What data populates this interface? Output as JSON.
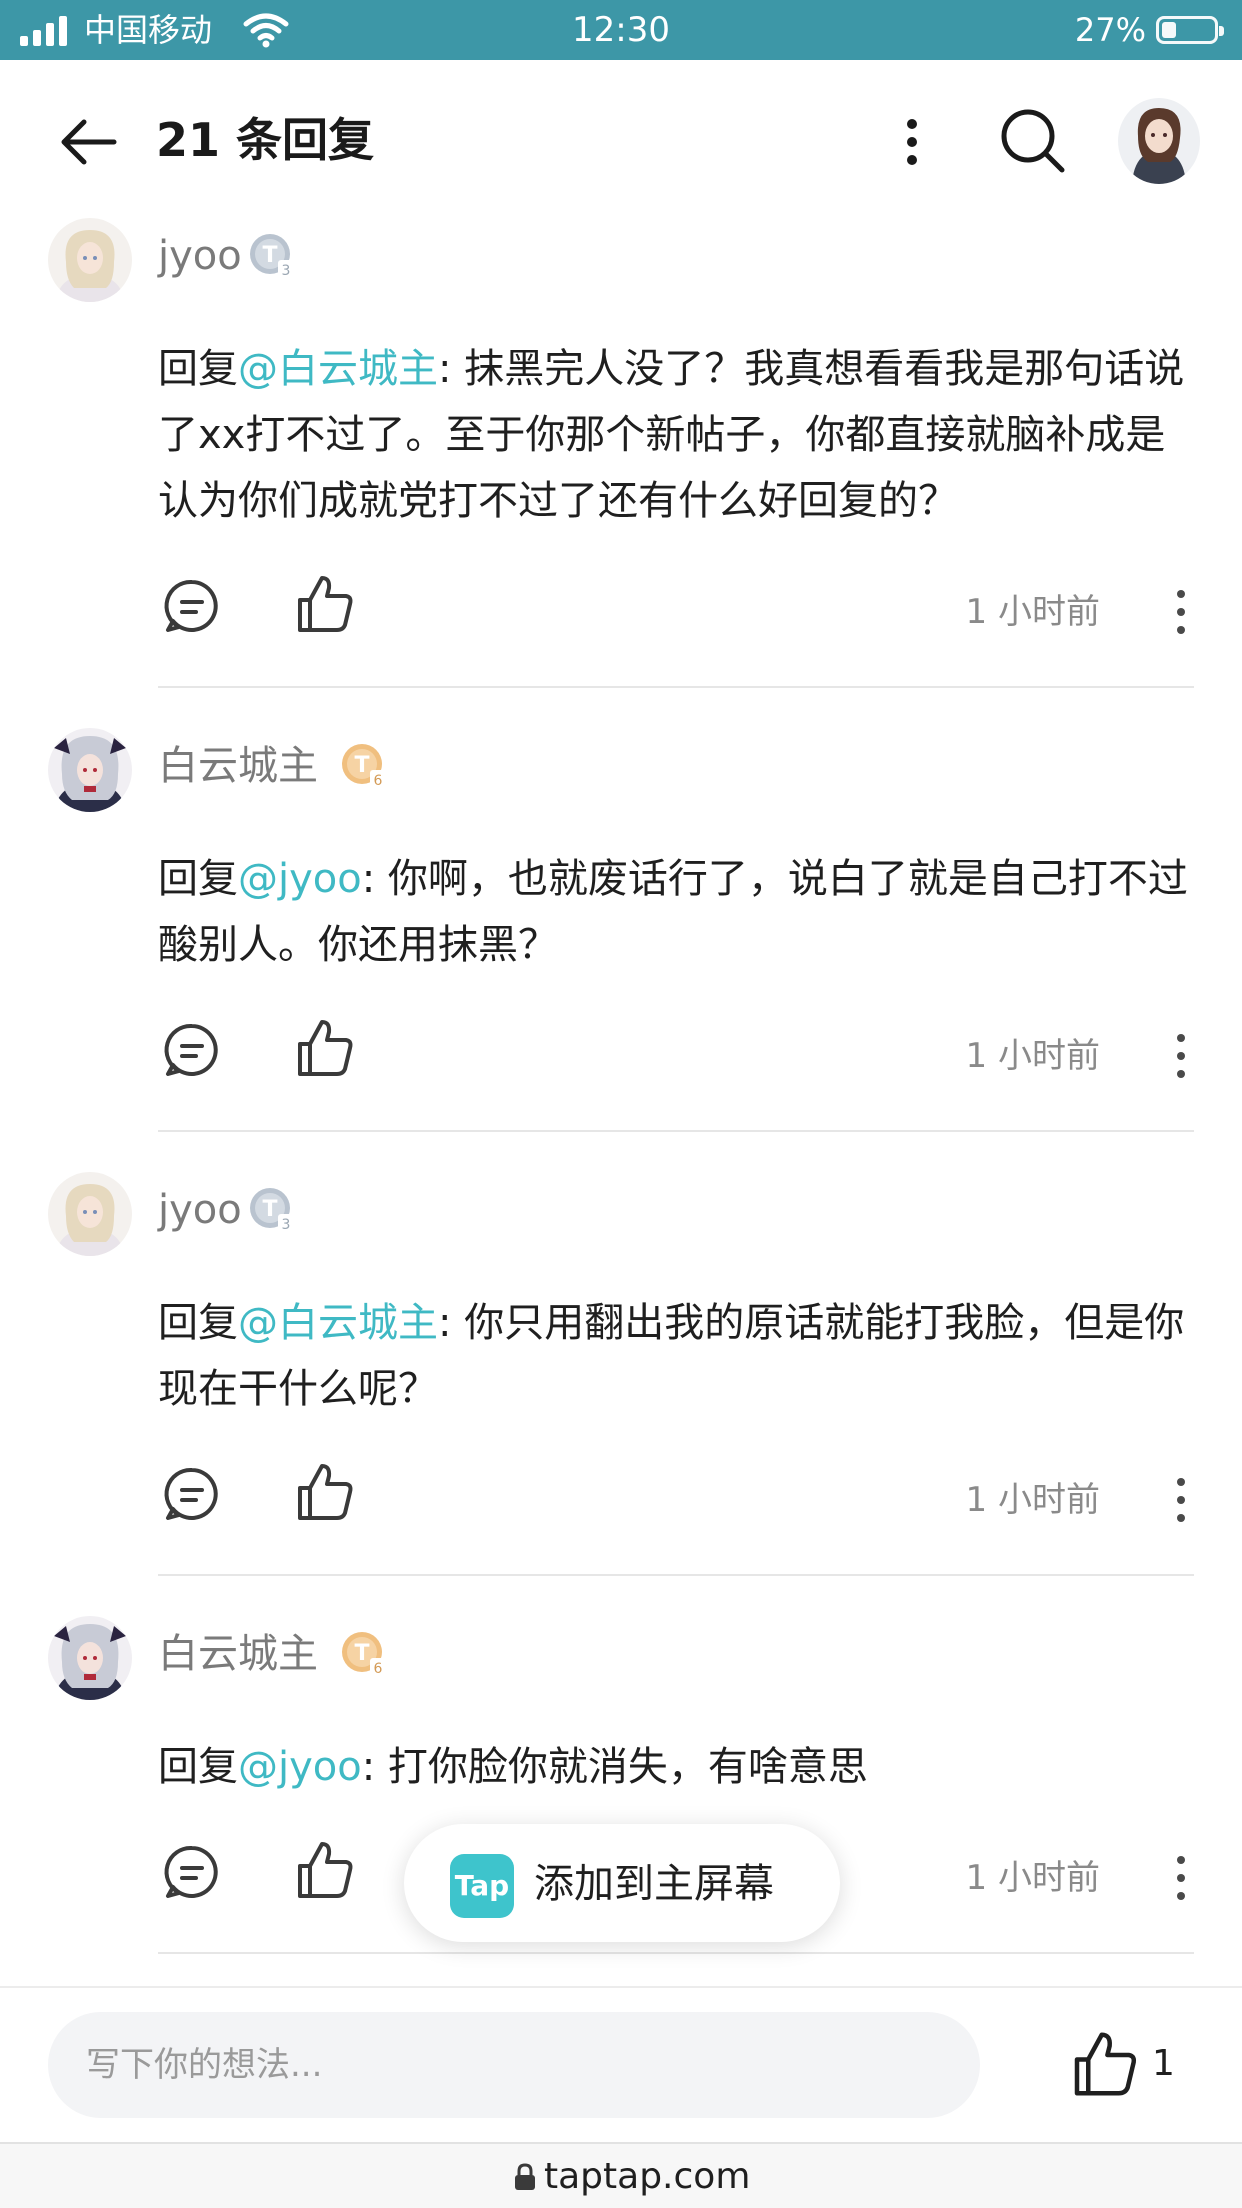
{
  "status_bar": {
    "carrier": "中国移动",
    "time": "12:30",
    "battery": "27%",
    "battery_level": 0.27
  },
  "header": {
    "title": "21 条回复",
    "icons": [
      "back-arrow-icon",
      "more-vertical-icon",
      "search-icon",
      "user-avatar"
    ]
  },
  "comments": [
    {
      "user": "jyoo",
      "badge_level": "3",
      "prefix": "回复",
      "mention": "@白云城主",
      "text": ": 抹黑完人没了？我真想看看我是那句话说了xx打不过了。至于你那个新帖子，你都直接就脑补成是认为你们成就党打不过了还有什么好回复的？",
      "time": "1 小时前"
    },
    {
      "user": "白云城主",
      "badge_level": "6",
      "prefix": "回复",
      "mention": "@jyoo",
      "text": ": 你啊，也就废话行了，说白了就是自己打不过酸别人。你还用抹黑？",
      "time": "1 小时前"
    },
    {
      "user": "jyoo",
      "badge_level": "3",
      "prefix": "回复",
      "mention": "@白云城主",
      "text": ": 你只用翻出我的原话就能打我脸，但是你现在干什么呢？",
      "time": "1 小时前"
    },
    {
      "user": "白云城主",
      "badge_level": "6",
      "prefix": "回复",
      "mention": "@jyoo",
      "text": ": 打你脸你就消失，有啥意思",
      "time": "1 小时前"
    }
  ],
  "toast": {
    "logo_text": "Tap",
    "label": "添加到主屏幕"
  },
  "bottom_bar": {
    "placeholder": "写下你的想法...",
    "like_count": "1"
  },
  "url_bar": {
    "url": "taptap.com"
  },
  "colors": {
    "status_bar": "#3d97a7",
    "mention": "#3fb9c4",
    "tap_brand": "#3ec4cc",
    "badge_silver": "#b9c3cf",
    "badge_gold": "#f0bf7f"
  }
}
